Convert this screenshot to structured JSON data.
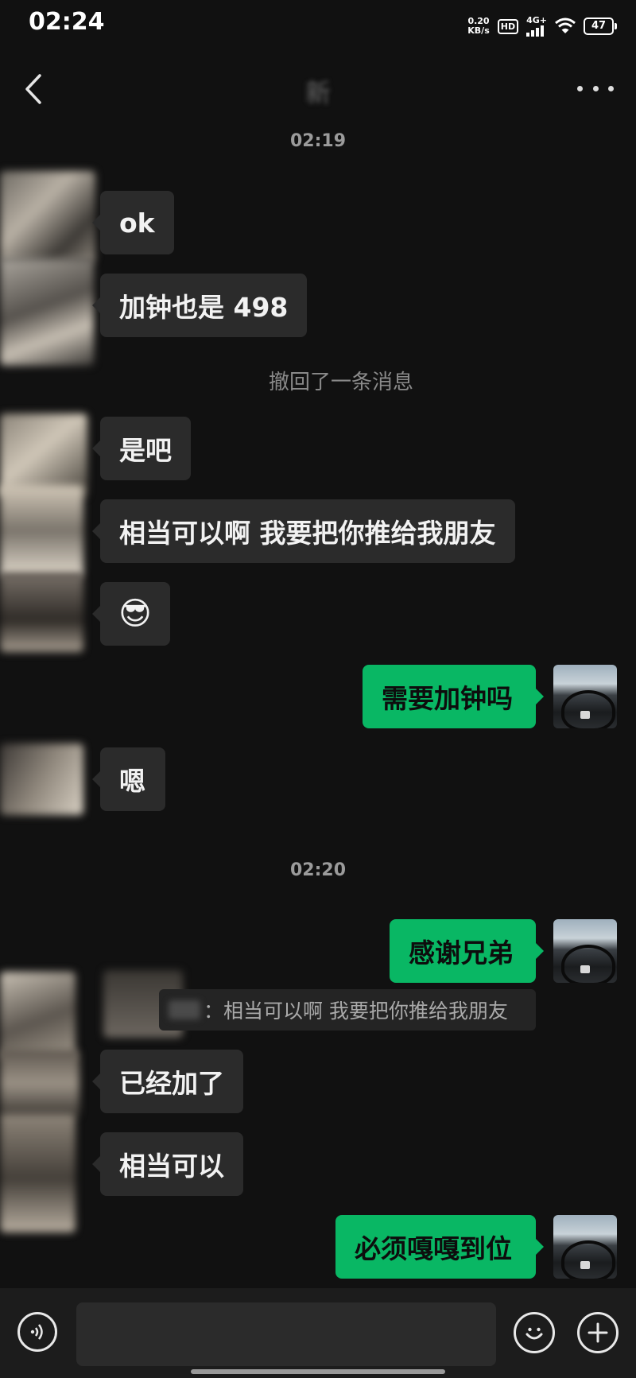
{
  "status_bar": {
    "time": "02:24",
    "net_speed_value": "0.20",
    "net_speed_unit": "KB/s",
    "hd_label": "HD",
    "network_label": "4G+",
    "battery": "47"
  },
  "header": {
    "back_icon": "chevron-left-icon",
    "title": "新",
    "more_icon": "more-horizontal-icon"
  },
  "messages": {
    "ts1": "02:19",
    "m1": "ok",
    "m2": "加钟也是 498",
    "recall_notice": "撤回了一条消息",
    "m3": "是吧",
    "m4": "相当可以啊 我要把你推给我朋友",
    "m5": "😎",
    "m6": "需要加钟吗",
    "m7": "嗯",
    "ts2": "02:20",
    "m8": "感谢兄弟",
    "quote_text": "：相当可以啊 我要把你推给我朋友",
    "m9": "已经加了",
    "m10": "相当可以",
    "m11": "必须嘎嘎到位"
  },
  "input_bar": {
    "voice_icon": "voice-icon",
    "input_value": "",
    "emoji_icon": "emoji-icon",
    "plus_icon": "plus-icon"
  },
  "colors": {
    "background": "#111111",
    "incoming_bubble": "#2b2b2b",
    "outgoing_bubble": "#09b764"
  }
}
